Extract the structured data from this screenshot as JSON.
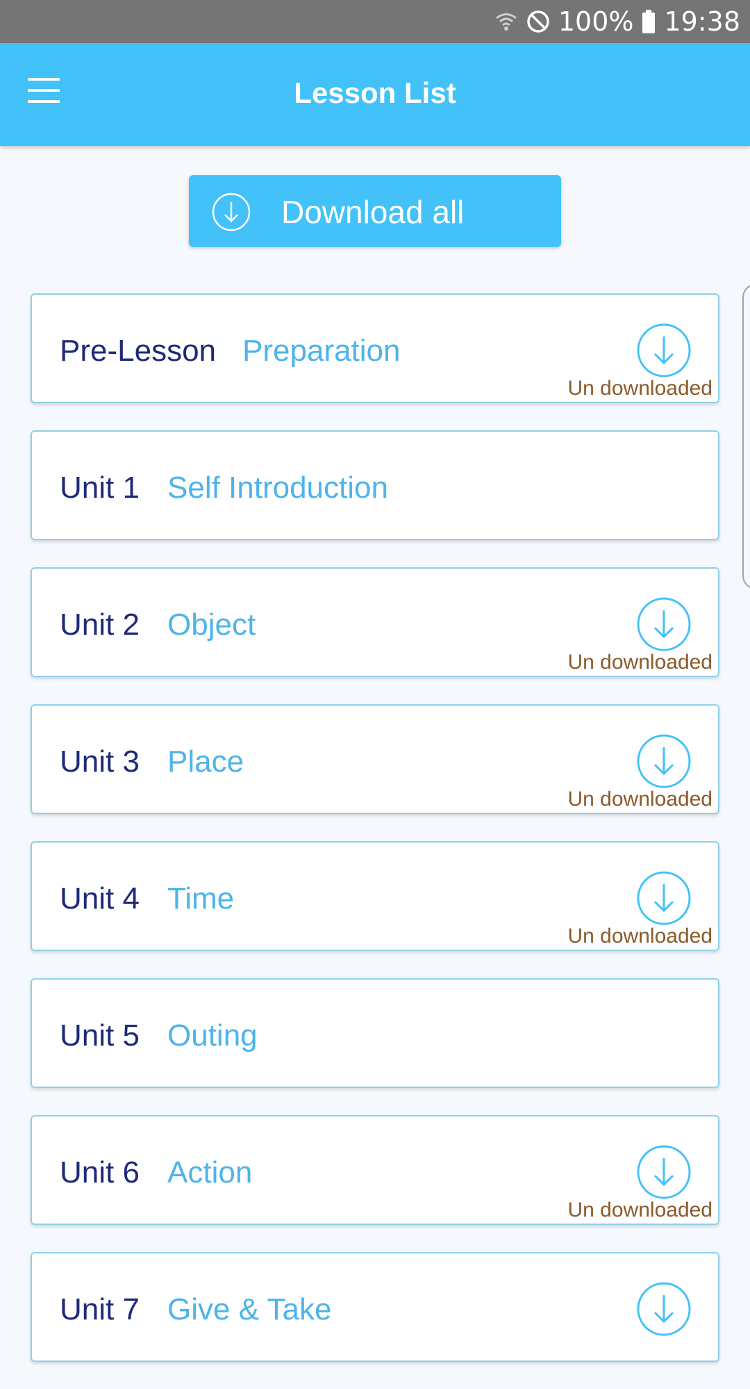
{
  "status_bar": {
    "battery_percent": "100%",
    "time": "19:38",
    "icons": [
      "wifi-icon",
      "do-not-disturb-icon",
      "battery-icon"
    ]
  },
  "app_bar": {
    "title": "Lesson List",
    "menu_icon": "hamburger-menu-icon"
  },
  "download_all": {
    "label": "Download all",
    "icon": "download-circle-icon"
  },
  "colors": {
    "app_bar": "#42c2f8",
    "unit_text": "#1e2a78",
    "lesson_title": "#4db4ea",
    "status_text": "#8a5a2b",
    "card_border": "#8fd0e8"
  },
  "lessons": [
    {
      "unit": "Pre-Lesson",
      "title": "Preparation",
      "status": "Un downloaded",
      "show_download": true
    },
    {
      "unit": "Unit 1",
      "title": "Self Introduction",
      "status": "",
      "show_download": false
    },
    {
      "unit": "Unit 2",
      "title": "Object",
      "status": "Un downloaded",
      "show_download": true
    },
    {
      "unit": "Unit 3",
      "title": "Place",
      "status": "Un downloaded",
      "show_download": true
    },
    {
      "unit": "Unit 4",
      "title": "Time",
      "status": "Un downloaded",
      "show_download": true
    },
    {
      "unit": "Unit 5",
      "title": "Outing",
      "status": "",
      "show_download": false
    },
    {
      "unit": "Unit 6",
      "title": "Action",
      "status": "Un downloaded",
      "show_download": true
    },
    {
      "unit": "Unit 7",
      "title": "Give & Take",
      "status": "",
      "show_download": true
    }
  ]
}
